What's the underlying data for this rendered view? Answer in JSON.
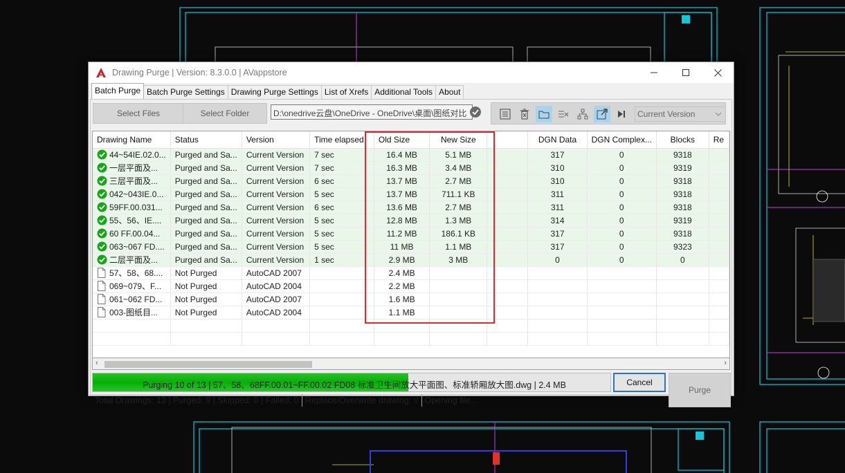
{
  "window": {
    "title": "Drawing Purge  | Version: 8.3.0.0  |   AVappstore"
  },
  "tabs": [
    {
      "label": "Batch Purge",
      "active": true
    },
    {
      "label": "Batch Purge Settings",
      "active": false
    },
    {
      "label": "Drawing Purge Settings",
      "active": false
    },
    {
      "label": "List of Xrefs",
      "active": false
    },
    {
      "label": "Additional Tools",
      "active": false
    },
    {
      "label": "About",
      "active": false
    }
  ],
  "toolbar": {
    "select_files": "Select Files",
    "select_folder": "Select Folder",
    "path": "D:\\onedrive云盘\\OneDrive - OneDrive\\桌面\\图纸对比",
    "version_select": "Current Version",
    "icons": [
      "list-icon",
      "delete-icon",
      "folder-icon",
      "clear-list-icon",
      "hierarchy-icon",
      "export-icon",
      "step-icon"
    ]
  },
  "grid": {
    "columns": [
      "Drawing Name",
      "Status",
      "Version",
      "Time elapsed",
      "Old Size",
      "New Size",
      "",
      "DGN Data",
      "DGN Complex...",
      "Blocks",
      "Re"
    ],
    "rows": [
      {
        "icon": "check-icon",
        "name": "44~54IE.02.0...",
        "status": "Purged and Sa...",
        "version": "Current Version",
        "time": "7 sec",
        "old": "16.4 MB",
        "new": "5.1 MB",
        "dgn": "317",
        "dgnc": "0",
        "blocks": "9318",
        "purged": true
      },
      {
        "icon": "check-icon",
        "name": "一层平面及...",
        "status": "Purged and Sa...",
        "version": "Current Version",
        "time": "7 sec",
        "old": "16.3 MB",
        "new": "3.4 MB",
        "dgn": "310",
        "dgnc": "0",
        "blocks": "9319",
        "purged": true
      },
      {
        "icon": "check-icon",
        "name": "三层平面及...",
        "status": "Purged and Sa...",
        "version": "Current Version",
        "time": "6 sec",
        "old": "13.7 MB",
        "new": "2.7 MB",
        "dgn": "310",
        "dgnc": "0",
        "blocks": "9318",
        "purged": true
      },
      {
        "icon": "check-icon",
        "name": "042~043IE.0...",
        "status": "Purged and Sa...",
        "version": "Current Version",
        "time": "5 sec",
        "old": "13.7 MB",
        "new": "711.1 KB",
        "dgn": "311",
        "dgnc": "0",
        "blocks": "9318",
        "purged": true
      },
      {
        "icon": "check-icon",
        "name": "59FF.00.031...",
        "status": "Purged and Sa...",
        "version": "Current Version",
        "time": "6 sec",
        "old": "13.6 MB",
        "new": "2.7 MB",
        "dgn": "311",
        "dgnc": "0",
        "blocks": "9318",
        "purged": true
      },
      {
        "icon": "check-icon",
        "name": "55、56、IE....",
        "status": "Purged and Sa...",
        "version": "Current Version",
        "time": "5 sec",
        "old": "12.8 MB",
        "new": "1.3 MB",
        "dgn": "314",
        "dgnc": "0",
        "blocks": "9319",
        "purged": true
      },
      {
        "icon": "check-icon",
        "name": "60 FF.00.04...",
        "status": "Purged and Sa...",
        "version": "Current Version",
        "time": "5 sec",
        "old": "11.2 MB",
        "new": "186.1 KB",
        "dgn": "317",
        "dgnc": "0",
        "blocks": "9318",
        "purged": true
      },
      {
        "icon": "check-icon",
        "name": "063~067 FD....",
        "status": "Purged and Sa...",
        "version": "Current Version",
        "time": "5 sec",
        "old": "11 MB",
        "new": "1.1 MB",
        "dgn": "317",
        "dgnc": "0",
        "blocks": "9323",
        "purged": true
      },
      {
        "icon": "check-icon",
        "name": "二层平面及...",
        "status": "Purged and Sa...",
        "version": "Current Version",
        "time": "1 sec",
        "old": "2.9 MB",
        "new": "3 MB",
        "dgn": "0",
        "dgnc": "0",
        "blocks": "0",
        "purged": true
      },
      {
        "icon": "document-icon",
        "name": "57、58、68....",
        "status": "Not Purged",
        "version": "AutoCAD 2007",
        "time": "",
        "old": "2.4 MB",
        "new": "",
        "dgn": "",
        "dgnc": "",
        "blocks": "",
        "purged": false
      },
      {
        "icon": "document-icon",
        "name": "069~079、F...",
        "status": "Not Purged",
        "version": "AutoCAD 2004",
        "time": "",
        "old": "2.2 MB",
        "new": "",
        "dgn": "",
        "dgnc": "",
        "blocks": "",
        "purged": false
      },
      {
        "icon": "document-icon",
        "name": "061~062 FD...",
        "status": "Not Purged",
        "version": "AutoCAD 2007",
        "time": "",
        "old": "1.6 MB",
        "new": "",
        "dgn": "",
        "dgnc": "",
        "blocks": "",
        "purged": false
      },
      {
        "icon": "document-icon",
        "name": "003-图纸目...",
        "status": "Not Purged",
        "version": "AutoCAD 2004",
        "time": "",
        "old": "1.1 MB",
        "new": "",
        "dgn": "",
        "dgnc": "",
        "blocks": "",
        "purged": false
      }
    ]
  },
  "progress": {
    "fraction": 0.61,
    "text": "Purging 10 of 13 | 57、58、68FF.00.01~FF.00.02 FD08 标准卫生间放大平面图、标准轿厢放大图.dwg |   2.4 MB",
    "cancel_label": "Cancel",
    "purge_label": "Purge"
  },
  "status": {
    "totals": "Total Drawings: 13 | Purged: 9 | Skipped: 0 | Failed: 0",
    "replace": "Replace/Overwrite drawing: √",
    "opening": "Opening file..."
  },
  "colors": {
    "accent_blue": "#2a74c6",
    "progress_green": "#06b006",
    "highlight_red": "#e0282e",
    "purged_row": "#eaf6ea"
  }
}
